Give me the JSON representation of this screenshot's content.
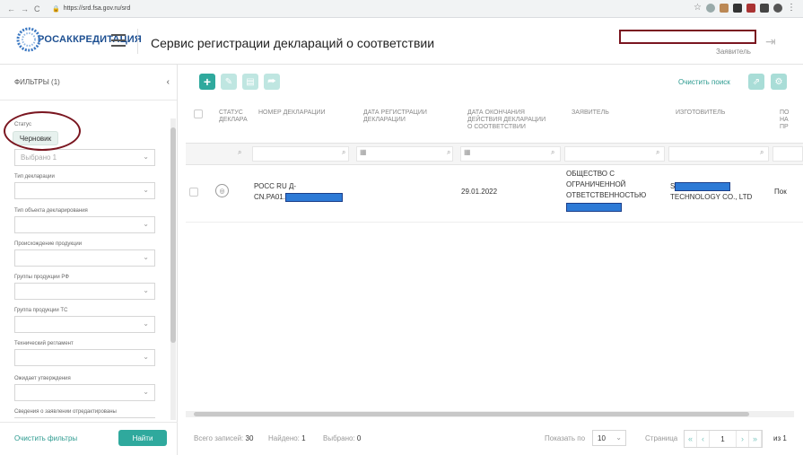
{
  "browser": {
    "url": "https://srd.fsa.gov.ru/srd",
    "back_icon": "←",
    "forward_icon": "→",
    "reload_icon": "C",
    "lock_icon": "🔒",
    "star_icon": "☆",
    "menu_icon": "⋮"
  },
  "header": {
    "logo_text": "РОСАККРЕДИТАЦИЯ",
    "title": "Сервис регистрации деклараций о соответствии",
    "user_role": "Заявитель",
    "logout_icon": "⇥"
  },
  "sidebar": {
    "title": "ФИЛЬТРЫ (1)",
    "collapse_icon": "‹",
    "status_label": "Статус",
    "status_chip": "Черновик",
    "status_select": "Выбрано 1",
    "fields": [
      {
        "label": "Тип декларации",
        "value": ""
      },
      {
        "label": "Тип объекта декларирования",
        "value": ""
      },
      {
        "label": "Происхождение продукции",
        "value": ""
      },
      {
        "label": "Группы продукции РФ",
        "value": ""
      },
      {
        "label": "Группа продукции ТС",
        "value": ""
      },
      {
        "label": "Технический регламент",
        "value": ""
      },
      {
        "label": "Ожидает утверждения",
        "value": ""
      },
      {
        "label": "Сведения о заявлении отредактированы",
        "value": ""
      }
    ],
    "clear_label": "Очистить фильтры",
    "find_label": "Найти"
  },
  "toolbar": {
    "add_icon": "+",
    "edit_icon": "✎",
    "print_icon": "▤",
    "sign_icon": "⮫",
    "clear_search": "Очистить поиск",
    "export_icon": "⇗",
    "settings_icon": "⚙"
  },
  "table": {
    "headers": [
      "СТАТУС\nДЕКЛАРА",
      "НОМЕР ДЕКЛАРАЦИИ",
      "ДАТА РЕГИСТРАЦИИ\nДЕКЛАРАЦИИ",
      "ДАТА ОКОНЧАНИЯ\nДЕЙСТВИЯ ДЕКЛАРАЦИИ\nО СООТВЕТСТВИИ",
      "ЗАЯВИТЕЛЬ",
      "ИЗГОТОВИТЕЛЬ",
      "ПО\nНА\nПР"
    ],
    "search_icon": "⌕",
    "calendar_icon": "▦",
    "rows": [
      {
        "status_icon": "◎",
        "number_line1": "РОСС RU Д-",
        "number_line2": "CN.PA01.",
        "reg_date": "",
        "end_date": "29.01.2022",
        "applicant_line1": "ОБЩЕСТВО С",
        "applicant_line2": "ОГРАНИЧЕННОЙ",
        "applicant_line3": "ОТВЕТСТВЕННОСТЬЮ",
        "manufacturer_line1": "S",
        "manufacturer_line2": "TECHNOLOGY CO., LTD",
        "extra": "Пок"
      }
    ]
  },
  "footer": {
    "total_label": "Всего записей:",
    "total": "30",
    "found_label": "Найдено:",
    "found": "1",
    "selected_label": "Выбрано:",
    "selected": "0",
    "per_page_label": "Показать по",
    "per_page": "10",
    "page_label": "Страница",
    "page": "1",
    "of_label": "из 1",
    "first_icon": "«",
    "prev_icon": "‹",
    "next_icon": "›",
    "last_icon": "»"
  }
}
